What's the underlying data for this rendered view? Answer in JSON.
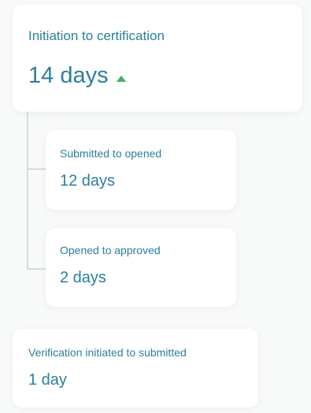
{
  "main_metric": {
    "label": "Initiation to certification",
    "value": "14 days",
    "trend_icon": "triangle-up-icon",
    "trend_color": "#3fae62"
  },
  "sub_metrics": [
    {
      "label": "Submitted to opened",
      "value": "12 days"
    },
    {
      "label": "Opened to approved",
      "value": "2 days"
    }
  ],
  "verification_metric": {
    "label": "Verification initiated to submitted",
    "value": "1 day"
  },
  "colors": {
    "accent_text": "#2b7f9c",
    "background": "#f8f9f9",
    "card": "#ffffff",
    "connector": "#d7dcde"
  }
}
